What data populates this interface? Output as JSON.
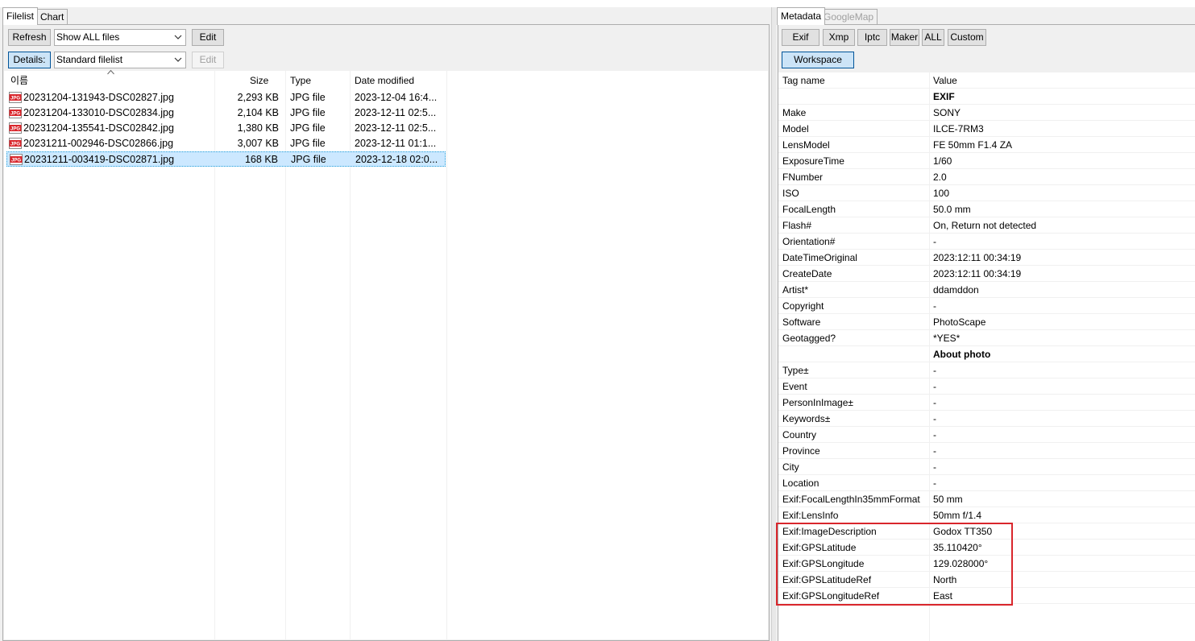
{
  "left_tabs": [
    {
      "label": "Filelist",
      "active": true
    },
    {
      "label": "Chart",
      "active": false
    }
  ],
  "toolbar": {
    "refresh_label": "Refresh",
    "filter_value": "Show ALL files",
    "edit_label": "Edit",
    "details_label": "Details:",
    "view_value": "Standard filelist",
    "edit2_label": "Edit"
  },
  "file_columns": [
    "이름",
    "Size",
    "Type",
    "Date modified"
  ],
  "files": [
    {
      "name": "20231204-131943-DSC02827.jpg",
      "size": "2,293 KB",
      "type": "JPG file",
      "date": "2023-12-04 16:4..."
    },
    {
      "name": "20231204-133010-DSC02834.jpg",
      "size": "2,104 KB",
      "type": "JPG file",
      "date": "2023-12-11 02:5..."
    },
    {
      "name": "20231204-135541-DSC02842.jpg",
      "size": "1,380 KB",
      "type": "JPG file",
      "date": "2023-12-11 02:5..."
    },
    {
      "name": "20231211-002946-DSC02866.jpg",
      "size": "3,007 KB",
      "type": "JPG file",
      "date": "2023-12-11 01:1..."
    },
    {
      "name": "20231211-003419-DSC02871.jpg",
      "size": "168 KB",
      "type": "JPG file",
      "date": "2023-12-18 02:0..."
    }
  ],
  "selected_file_index": 4,
  "right_tabs": [
    {
      "label": "Metadata",
      "active": true
    },
    {
      "label": "GoogleMap",
      "active": false
    }
  ],
  "meta_buttons": [
    "Exif",
    "Xmp",
    "Iptc",
    "Maker",
    "ALL",
    "Custom"
  ],
  "workspace_label": "Workspace",
  "meta_columns": {
    "tag": "Tag name",
    "value": "Value"
  },
  "meta_rows": [
    {
      "k": "",
      "v": "EXIF",
      "section": true
    },
    {
      "k": "Make",
      "v": "SONY"
    },
    {
      "k": "Model",
      "v": "ILCE-7RM3"
    },
    {
      "k": "LensModel",
      "v": "FE 50mm F1.4 ZA"
    },
    {
      "k": "ExposureTime",
      "v": "1/60"
    },
    {
      "k": "FNumber",
      "v": "2.0"
    },
    {
      "k": "ISO",
      "v": "100"
    },
    {
      "k": "FocalLength",
      "v": "50.0 mm"
    },
    {
      "k": "Flash#",
      "v": "On, Return not detected"
    },
    {
      "k": "Orientation#",
      "v": "-"
    },
    {
      "k": "DateTimeOriginal",
      "v": "2023:12:11 00:34:19"
    },
    {
      "k": "CreateDate",
      "v": "2023:12:11 00:34:19"
    },
    {
      "k": "Artist*",
      "v": "ddamddon"
    },
    {
      "k": "Copyright",
      "v": "-"
    },
    {
      "k": "Software",
      "v": "PhotoScape"
    },
    {
      "k": "Geotagged?",
      "v": "*YES*"
    },
    {
      "k": "",
      "v": "About photo",
      "section": true
    },
    {
      "k": "Type±",
      "v": "-"
    },
    {
      "k": "Event",
      "v": "-"
    },
    {
      "k": "PersonInImage±",
      "v": "-"
    },
    {
      "k": "Keywords±",
      "v": "-"
    },
    {
      "k": "Country",
      "v": "-"
    },
    {
      "k": "Province",
      "v": "-"
    },
    {
      "k": "City",
      "v": "-"
    },
    {
      "k": "Location",
      "v": "-"
    },
    {
      "k": "Exif:FocalLengthIn35mmFormat",
      "v": "50 mm"
    },
    {
      "k": "Exif:LensInfo",
      "v": "50mm f/1.4"
    },
    {
      "k": "Exif:ImageDescription",
      "v": "Godox TT350"
    },
    {
      "k": "Exif:GPSLatitude",
      "v": "35.110420°"
    },
    {
      "k": "Exif:GPSLongitude",
      "v": "129.028000°"
    },
    {
      "k": "Exif:GPSLatitudeRef",
      "v": "North"
    },
    {
      "k": "Exif:GPSLongitudeRef",
      "v": "East"
    }
  ],
  "colors": {
    "highlight": "#d9262c",
    "selection": "#cce8ff",
    "jpg_icon": "#d9262c"
  }
}
